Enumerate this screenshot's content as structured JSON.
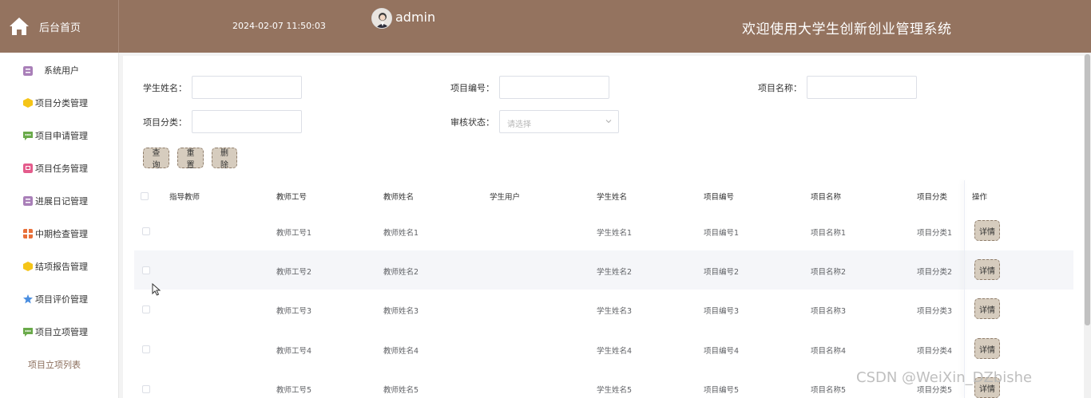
{
  "header": {
    "home_label": "后台首页",
    "datetime": "2024-02-07 11:50:03",
    "username": "admin",
    "system_title": "欢迎使用大学生创新创业管理系统"
  },
  "sidebar": {
    "items": [
      {
        "label": "系统用户",
        "icon": "user-box-icon",
        "color": "#a97fb8"
      },
      {
        "label": "项目分类管理",
        "icon": "cube-icon",
        "color": "#f5c518"
      },
      {
        "label": "项目申请管理",
        "icon": "chat-bubble-icon",
        "color": "#6aaa4a"
      },
      {
        "label": "项目任务管理",
        "icon": "task-icon",
        "color": "#e45c8c"
      },
      {
        "label": "进展日记管理",
        "icon": "user-box-icon",
        "color": "#a97fb8"
      },
      {
        "label": "中期检查管理",
        "icon": "grid-icon",
        "color": "#e8703a"
      },
      {
        "label": "结项报告管理",
        "icon": "cube-icon",
        "color": "#f5c518"
      },
      {
        "label": "项目评价管理",
        "icon": "star-icon",
        "color": "#4a8ee0"
      },
      {
        "label": "项目立项管理",
        "icon": "chat-bubble-icon",
        "color": "#6aaa4a"
      }
    ],
    "sub_item": "项目立项列表"
  },
  "search": {
    "student_name_label": "学生姓名：",
    "project_no_label": "项目编号：",
    "project_name_label": "项目名称：",
    "category_label": "项目分类：",
    "status_label": "审核状态：",
    "status_placeholder": "请选择",
    "query_button": "查询",
    "reset_button": "重置",
    "delete_button": "删除"
  },
  "table": {
    "headers": [
      "指导教师",
      "教师工号",
      "教师姓名",
      "学生用户",
      "学生姓名",
      "项目编号",
      "项目名称",
      "项目分类",
      "操作"
    ],
    "rows": [
      {
        "teacher_id": "教师工号1",
        "teacher_name": "教师姓名1",
        "student_user": "",
        "student_name": "学生姓名1",
        "project_no": "项目编号1",
        "project_name": "项目名称1",
        "category": "项目分类1"
      },
      {
        "teacher_id": "教师工号2",
        "teacher_name": "教师姓名2",
        "student_user": "",
        "student_name": "学生姓名2",
        "project_no": "项目编号2",
        "project_name": "项目名称2",
        "category": "项目分类2"
      },
      {
        "teacher_id": "教师工号3",
        "teacher_name": "教师姓名3",
        "student_user": "",
        "student_name": "学生姓名3",
        "project_no": "项目编号3",
        "project_name": "项目名称3",
        "category": "项目分类3"
      },
      {
        "teacher_id": "教师工号4",
        "teacher_name": "教师姓名4",
        "student_user": "",
        "student_name": "学生姓名4",
        "project_no": "项目编号4",
        "project_name": "项目名称4",
        "category": "项目分类4"
      },
      {
        "teacher_id": "教师工号5",
        "teacher_name": "教师姓名5",
        "student_user": "",
        "student_name": "学生姓名5",
        "project_no": "项目编号5",
        "project_name": "项目名称5",
        "category": "项目分类5"
      }
    ],
    "detail_button": "详情"
  },
  "watermark": "CSDN @WeiXin_DZbishe",
  "colors": {
    "header_bg": "#94735f",
    "button_bg": "#d6ccbe",
    "button_border": "#8f7d6b"
  }
}
